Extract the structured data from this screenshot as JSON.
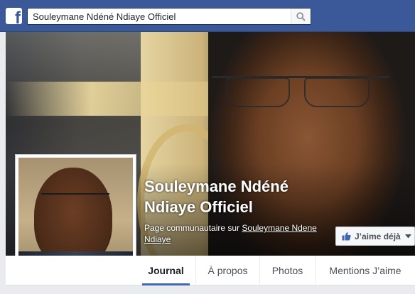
{
  "header": {
    "search_value": "Souleymane Ndéné Ndiaye Officiel",
    "logo_letter": "f",
    "brand_color": "#3b5998"
  },
  "page": {
    "title": "Souleymane Ndéné Ndiaye Officiel",
    "category_prefix": "Page communautaire sur ",
    "category_link": "Souleymane Ndene Ndiaye"
  },
  "like_button": {
    "label": "J’aime déjà"
  },
  "tabs": [
    {
      "label": "Journal",
      "active": true
    },
    {
      "label": "À propos",
      "active": false
    },
    {
      "label": "Photos",
      "active": false
    },
    {
      "label": "Mentions J’aime",
      "active": false
    }
  ],
  "icons": {
    "search": "search-icon",
    "like": "thumbs-up-icon",
    "dropdown": "caret-down-icon"
  }
}
